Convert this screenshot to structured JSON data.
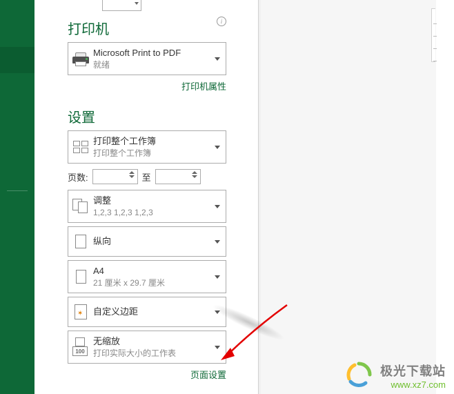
{
  "printer": {
    "section_title": "打印机",
    "name": "Microsoft Print to PDF",
    "status": "就绪",
    "properties_link": "打印机属性"
  },
  "settings": {
    "section_title": "设置",
    "print_scope": {
      "label": "打印整个工作簿",
      "sub": "打印整个工作簿"
    },
    "pages": {
      "label": "页数:",
      "to_label": "至",
      "from": "",
      "to": ""
    },
    "collate": {
      "label": "调整",
      "sub": "1,2,3    1,2,3    1,2,3"
    },
    "orientation": {
      "label": "纵向"
    },
    "paper": {
      "label": "A4",
      "sub": "21 厘米 x 29.7 厘米"
    },
    "margins": {
      "label": "自定义边距"
    },
    "scaling": {
      "label": "无缩放",
      "sub": "打印实际大小的工作表",
      "badge": "100"
    },
    "page_setup_link": "页面设置"
  },
  "watermark": {
    "title": "极光下载站",
    "url": "www.xz7.com"
  }
}
